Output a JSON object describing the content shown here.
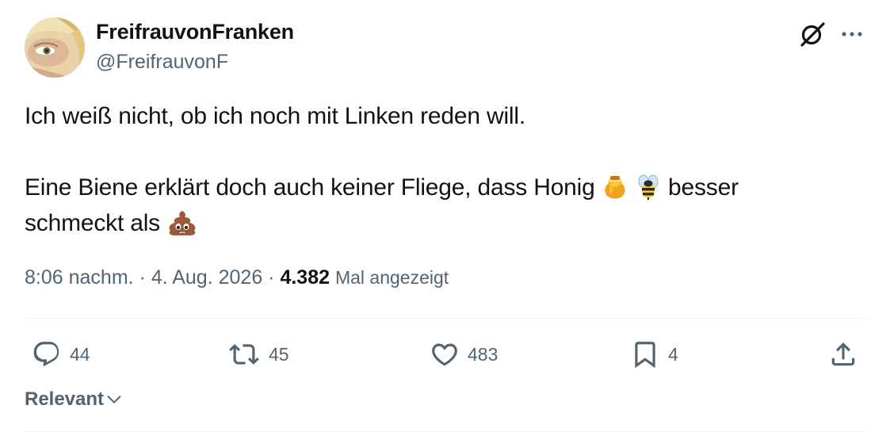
{
  "author": {
    "display_name": "FreifrauvonFranken",
    "handle": "@FreifrauvonF",
    "avatar_icon": "avatar-photo"
  },
  "header_icons": {
    "grok": "grok-icon",
    "more": "more-options-icon"
  },
  "tweet": {
    "line1": "Ich weiß nicht, ob ich noch mit Linken reden will.",
    "line2_part1": "Eine Biene erklärt doch auch keiner Fliege, dass Honig ",
    "line2_part2": " besser",
    "line3_part1": "schmeckt als ",
    "emojis": [
      "honey-pot-emoji",
      "bee-emoji",
      "pile-of-poo-emoji"
    ]
  },
  "meta": {
    "time": "8:06 nachm.",
    "separator": " · ",
    "date": "4. Aug. 2026",
    "views_count": "4.382",
    "views_label": "Mal angezeigt"
  },
  "actions": {
    "reply_count": "44",
    "retweet_count": "45",
    "like_count": "483",
    "bookmark_count": "4"
  },
  "sort": {
    "label": "Relevant"
  },
  "colors": {
    "text": "#0f1419",
    "secondary": "#536471",
    "divider": "#eff3f4"
  }
}
